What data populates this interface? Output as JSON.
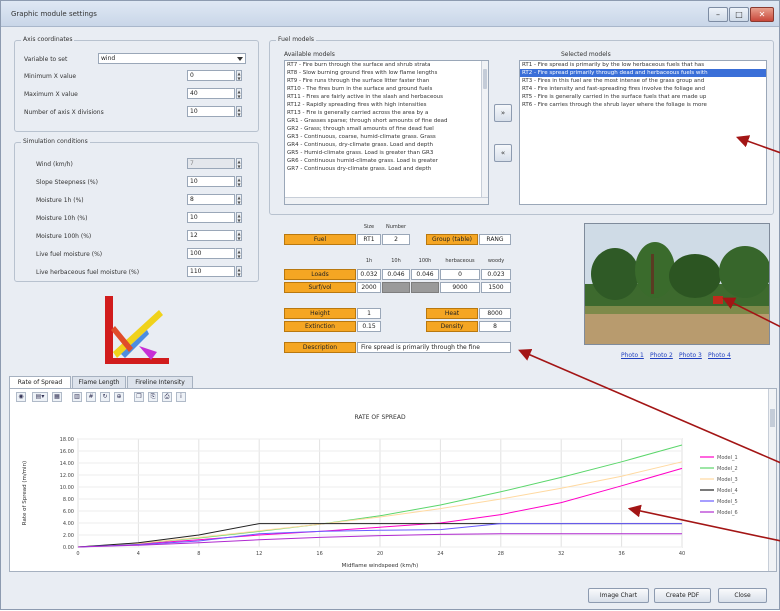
{
  "window": {
    "title": "Graphic module settings",
    "btn_min": "–",
    "btn_max": "□",
    "btn_close": "✕"
  },
  "axis": {
    "group_label": "Axis coordinates",
    "variable_label": "Variable to set",
    "variable_value": "wind",
    "min_x_label": "Minimum X value",
    "min_x": "0",
    "max_x_label": "Maximum X value",
    "max_x": "40",
    "div_label": "Number of axis X divisions",
    "div": "10"
  },
  "sim": {
    "group_label": "Simulation conditions",
    "rows": [
      {
        "label": "Wind (km/h)",
        "value": "7",
        "disabled": true
      },
      {
        "label": "Slope Steepness (%)",
        "value": "10",
        "disabled": false
      },
      {
        "label": "Moisture 1h (%)",
        "value": "8",
        "disabled": false
      },
      {
        "label": "Moisture 10h (%)",
        "value": "10",
        "disabled": false
      },
      {
        "label": "Moisture 100h (%)",
        "value": "12",
        "disabled": false
      },
      {
        "label": "Live fuel moisture (%)",
        "value": "100",
        "disabled": false
      },
      {
        "label": "Live herbaceous fuel moisture (%)",
        "value": "110",
        "disabled": false
      }
    ]
  },
  "fuel": {
    "group_label": "Fuel models",
    "available_label": "Available models",
    "available": [
      "RT7 - Fire burn through the surface and shrub strata",
      "RT8 - Slow burning ground fires with low flame lengths",
      "RT9 - Fire runs through the surface litter faster than",
      "RT10 - The fires burn in the surface and ground fuels",
      "RT11 - Fires are fairly active in the slash and herbaceous",
      "RT12 - Rapidly spreading fires with high intensities",
      "RT13 - Fire is generally carried across the area by a",
      "GR1 - Grasses sparse; through short amounts of fine dead",
      "GR2 - Grass; through small amounts of fine dead fuel",
      "GR3 - Continuous, coarse, humid-climate grass. Grass",
      "GR4 - Continuous, dry-climate grass. Load and depth",
      "GR5 - Humid-climate grass. Load is greater than GR3",
      "GR6 - Continuous humid-climate grass. Load is greater",
      "GR7 - Continuous dry-climate grass. Load and depth"
    ],
    "selected_label": "Selected models",
    "selected": [
      "RT1 - Fire spread is primarily by the low herbaceous fuels that has",
      "RT2 - Fire spread primarily through dead and herbaceous fuels with",
      "RT3 - Fires in this fuel are the most intense of the grass group and",
      "RT4 - Fire intensity and fast-spreading fires involve the foliage and",
      "RT5 - Fire is generally carried in the surface fuels that are made up",
      "RT6 - Fire carries through the shrub layer where the foliage is more"
    ],
    "selected_index": 1,
    "add_btn": "»",
    "remove_btn": "«"
  },
  "details": {
    "fuel_label": "Fuel",
    "size_hdr": "Size",
    "number_hdr": "Number",
    "fuel_code": "RT1",
    "fuel_number": "2",
    "group_label": "Group (table)",
    "group_value": "RANG",
    "c1h": "1h",
    "c10h": "10h",
    "c100h": "100h",
    "cherb": "herbaceous",
    "cwoody": "woody",
    "loads_label": "Loads",
    "loads": [
      "0.032",
      "0.046",
      "0.046",
      "0",
      "0.023"
    ],
    "sv_label": "Surf/vol",
    "sv": [
      "2000",
      "",
      "",
      "9000",
      "1500"
    ],
    "height_label": "Height",
    "height": "1",
    "ext_label": "Extinction",
    "ext": "0.15",
    "heat_label": "Heat",
    "heat": "8000",
    "density_label": "Density",
    "density": "8",
    "desc_label": "Description",
    "desc": "Fire spread is primarily through the fine"
  },
  "photo": {
    "links": [
      "Photo 1",
      "Photo 2",
      "Photo 3",
      "Photo 4"
    ]
  },
  "tabs": [
    "Rate of Spread",
    "Flame Length",
    "Fireline Intensity"
  ],
  "chart_data": {
    "type": "line",
    "title": "RATE OF SPREAD",
    "xlabel": "Midflame windspeed (km/h)",
    "ylabel": "Rate of Spread (m/min)",
    "xlim": [
      0,
      40
    ],
    "ylim": [
      0,
      18
    ],
    "x_ticks": [
      "0",
      "4",
      "8",
      "12",
      "16",
      "20",
      "24",
      "28",
      "32",
      "36",
      "40"
    ],
    "y_ticks": [
      "0.00",
      "2.00",
      "4.00",
      "6.00",
      "8.00",
      "10.00",
      "12.00",
      "14.00",
      "16.00",
      "18.00"
    ],
    "x": [
      0,
      4,
      8,
      12,
      16,
      20,
      24,
      28,
      32,
      36,
      40
    ],
    "series": [
      {
        "name": "Model_1",
        "color": "#ff00c8",
        "values": [
          0,
          0.5,
          1.2,
          2.0,
          2.6,
          3.3,
          4.0,
          5.4,
          7.4,
          10.2,
          13.1
        ]
      },
      {
        "name": "Model_2",
        "color": "#5bd66b",
        "values": [
          0,
          0.6,
          1.5,
          2.6,
          3.8,
          5.2,
          7.0,
          9.2,
          11.6,
          14.2,
          17.0
        ]
      },
      {
        "name": "Model_3",
        "color": "#ffd9a0",
        "values": [
          0,
          0.6,
          1.6,
          2.7,
          3.8,
          5.0,
          6.4,
          8.0,
          9.8,
          11.8,
          14.2
        ]
      },
      {
        "name": "Model_4",
        "color": "#222222",
        "values": [
          0,
          0.7,
          2.0,
          3.9,
          3.9,
          3.9,
          3.9,
          3.9,
          3.9,
          3.9,
          3.9
        ]
      },
      {
        "name": "Model_5",
        "color": "#6a5cff",
        "values": [
          0,
          0.4,
          1.0,
          2.2,
          2.6,
          2.8,
          2.9,
          3.9,
          3.9,
          3.9,
          3.9
        ]
      },
      {
        "name": "Model_6",
        "color": "#b02ad0",
        "values": [
          0,
          0.3,
          0.7,
          1.2,
          1.6,
          1.9,
          2.1,
          2.2,
          2.2,
          2.2,
          2.2
        ]
      }
    ],
    "legend": "right",
    "grid": true
  },
  "footer": {
    "image_btn": "Image Chart",
    "pdf_btn": "Create PDF",
    "close_btn": "Close"
  }
}
